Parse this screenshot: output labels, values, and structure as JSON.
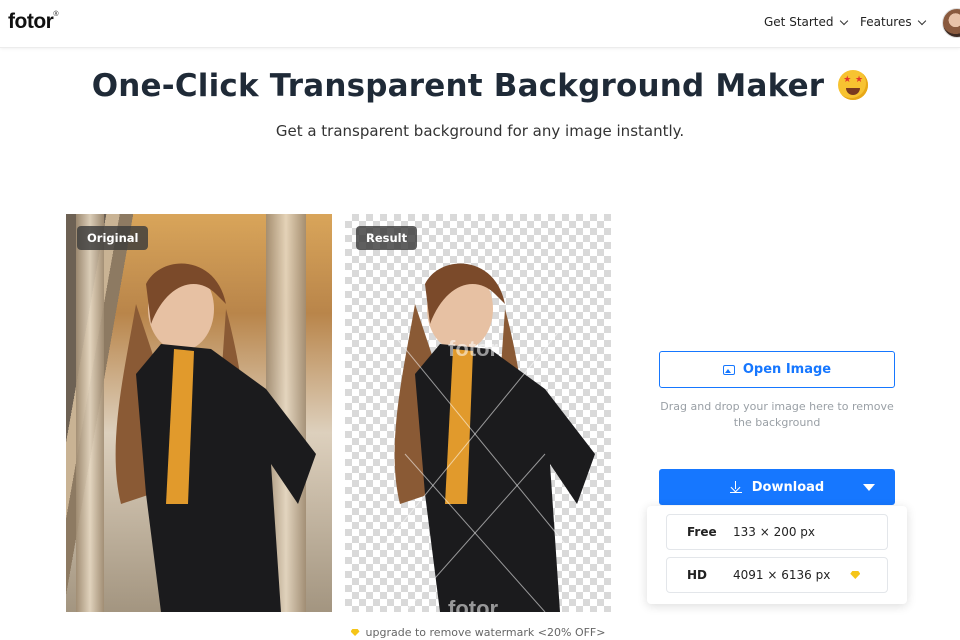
{
  "header": {
    "logo": "fotor",
    "logo_mark": "®",
    "nav": [
      {
        "label": "Get Started"
      },
      {
        "label": "Features"
      }
    ]
  },
  "hero": {
    "title": "One-Click Transparent Background Maker",
    "subtitle": "Get a transparent background for any image instantly."
  },
  "preview": {
    "original_tag": "Original",
    "result_tag": "Result",
    "watermark": "fotor"
  },
  "actions": {
    "open_image": "Open Image",
    "drag_hint": "Drag and drop your image here to remove the background",
    "download": "Download",
    "options": [
      {
        "key": "Free",
        "size": "133 × 200 px",
        "premium": false
      },
      {
        "key": "HD",
        "size": "4091 × 6136 px",
        "premium": true
      }
    ],
    "upgrade_note": "upgrade to remove watermark <20% OFF>"
  },
  "colors": {
    "accent": "#1677ff",
    "premium": "#f5c518",
    "text": "#1f2a37"
  },
  "icons": [
    "chevron-down-icon",
    "image-icon",
    "download-icon",
    "caret-down-icon",
    "diamond-icon",
    "emoji-star-struck-icon"
  ]
}
